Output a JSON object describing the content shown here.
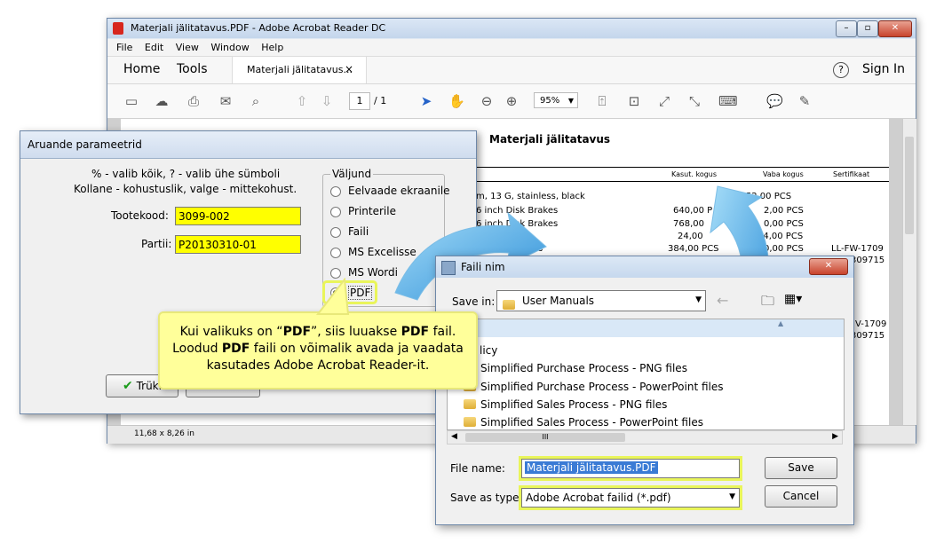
{
  "acrobat": {
    "title": "Materjali jälitatavus.PDF - Adobe Acrobat Reader DC",
    "menu": [
      "File",
      "Edit",
      "View",
      "Window",
      "Help"
    ],
    "tabs": {
      "home": "Home",
      "tools": "Tools",
      "doc": "Materjali jälitatavus...",
      "close": "×",
      "help": "?",
      "sign_in": "Sign In"
    },
    "toolbar": {
      "page_current": "1",
      "page_total": "/ 1",
      "zoom": "95%"
    },
    "document": {
      "heading": "Materjali jälitatavus",
      "columns": [
        "Kasut. kogus",
        "Vaba kogus",
        "Sertifikaat"
      ],
      "rows": [
        {
          "desc": "m, 13 G, stainless, black",
          "kasut": "8.352,00 PCS",
          "vaba": "",
          "cert": ""
        },
        {
          "desc": "6 inch Disk Brakes",
          "kasut": "640,00 P",
          "vaba": "2,00 PCS",
          "cert": ""
        },
        {
          "desc": "6 inch Disk Brakes",
          "kasut": "768,00",
          "vaba": "0,00 PCS",
          "cert": ""
        },
        {
          "desc": "",
          "kasut": "24,00",
          "vaba": "24,00 PCS",
          "cert": ""
        },
        {
          "desc": "s",
          "kasut": "384,00 PCS",
          "vaba": "0,00 PCS",
          "cert": "LL-FW-1709"
        },
        {
          "desc": "",
          "kasut": "",
          "vaba": "",
          "cert": "309715"
        },
        {
          "desc": "",
          "kasut": "",
          "vaba": "",
          "cert": "V-1709"
        },
        {
          "desc": "",
          "kasut": "",
          "vaba": "",
          "cert": "309715"
        }
      ]
    },
    "status": "11,68 x 8,26 in"
  },
  "aruande": {
    "title": "Aruande parameetrid",
    "hint1": "% - valib kõik, ? - valib ühe sümboli",
    "hint2": "Kollane - kohustuslik, valge - mittekohust.",
    "tootekood_label": "Tootekood:",
    "tootekood_value": "3099-002",
    "partii_label": "Partii:",
    "partii_value": "P20130310-01",
    "valjund_label": "Väljund",
    "options": [
      "Eelvaade ekraanile",
      "Printerile",
      "Faili",
      "MS Excelisse",
      "MS Wordi",
      "PDF"
    ],
    "selected": "PDF",
    "print_button": "Trüki",
    "cancel_button": "Katkesta"
  },
  "callout": {
    "line1_pre": "Kui valikuks on “",
    "line1_b1": "PDF",
    "line1_mid": "”, siis luuakse ",
    "line1_b2": "PDF",
    "line1_post": " fail.",
    "line2_pre": "Loodud ",
    "line2_b": "PDF",
    "line2_post": " faili on võimalik avada ja vaadata",
    "line3": "kasutades Adobe Acrobat Reader-it."
  },
  "save_dialog": {
    "title": "Faili nim",
    "save_in_label": "Save in:",
    "save_in_value": "User Manuals",
    "files": [
      "licy",
      "Simplified Purchase Process - PNG files",
      "Simplified Purchase Process - PowerPoint files",
      "Simplified Sales Process - PNG files",
      "Simplified Sales Process - PowerPoint files"
    ],
    "scroll_thumb": "III",
    "file_name_label": "File name:",
    "file_name_value": "Materjali jälitatavus.PDF",
    "save_type_label": "Save as type:",
    "save_type_value": "Adobe Acrobat failid (*.pdf)",
    "save_button": "Save",
    "cancel_button": "Cancel"
  },
  "colors": {
    "required_field": "#ffff00",
    "highlight": "#e9f55a",
    "callout_bg": "#ffff9a",
    "arrow": "#3aa0e0"
  }
}
